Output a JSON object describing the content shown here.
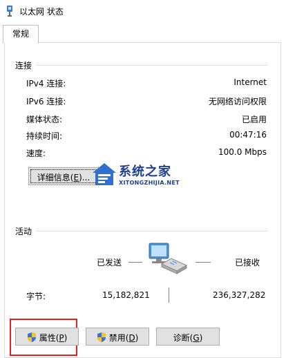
{
  "window": {
    "title": "以太网 状态"
  },
  "tabs": [
    {
      "label": "常规"
    }
  ],
  "connection": {
    "group_title": "连接",
    "rows": [
      {
        "label": "IPv4 连接:",
        "value": "Internet"
      },
      {
        "label": "IPv6 连接:",
        "value": "无网络访问权限"
      },
      {
        "label": "媒体状态:",
        "value": "已启用"
      },
      {
        "label": "持续时间:",
        "value": "00:47:16"
      },
      {
        "label": "速度:",
        "value": "100.0 Mbps"
      }
    ],
    "details_button": {
      "label": "详细信息(",
      "mnemonic": "E",
      "suffix": ")..."
    }
  },
  "activity": {
    "group_title": "活动",
    "sent_label": "已发送",
    "received_label": "已接收",
    "bytes_label": "字节:",
    "bytes_sent": "15,182,821",
    "bytes_received": "236,327,282"
  },
  "buttons": {
    "properties": {
      "label": "属性(",
      "mnemonic": "P",
      "suffix": ")"
    },
    "disable": {
      "label": "禁用(",
      "mnemonic": "D",
      "suffix": ")"
    },
    "diagnose": {
      "label": "诊断(",
      "mnemonic": "G",
      "suffix": ")"
    }
  },
  "watermark": {
    "name": "系统之家",
    "url": "XITONGZHIJIA.NET"
  },
  "icons": {
    "title": "network-adapter-icon",
    "activity": "network-computers-icon",
    "shield": "uac-shield-icon"
  },
  "colors": {
    "highlight": "#e02020",
    "watermark": "#1c3f8f"
  }
}
